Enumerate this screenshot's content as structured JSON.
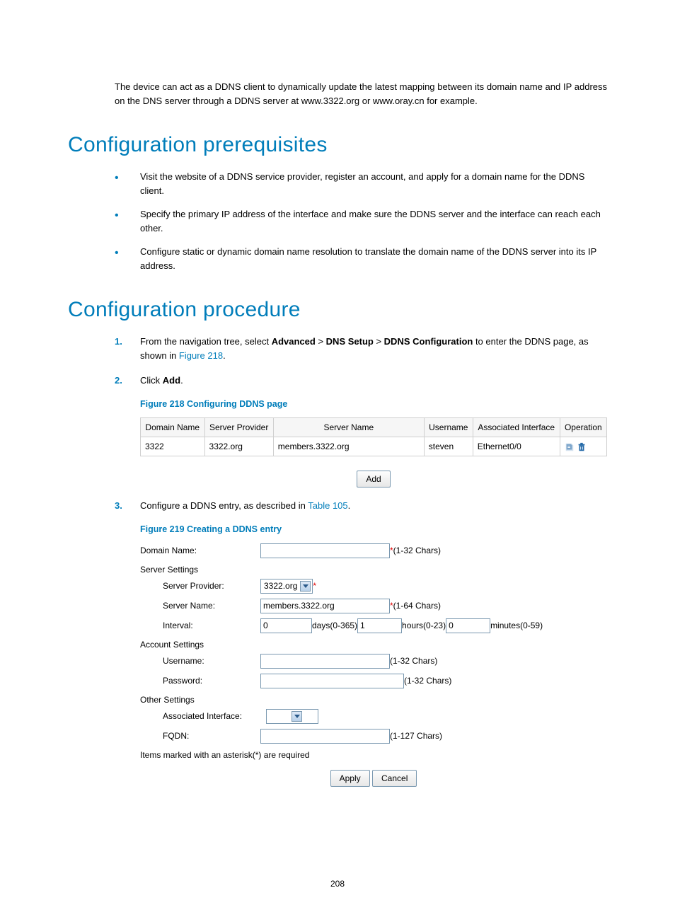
{
  "intro": "The device can act as a DDNS client to dynamically update the latest mapping between its domain name and IP address on the DNS server through a DDNS server at www.3322.org or www.oray.cn for example.",
  "headings": {
    "prereq": "Configuration prerequisites",
    "procedure": "Configuration procedure"
  },
  "prereq_items": [
    "Visit the website of a DDNS service provider, register an account, and apply for a domain name for the DDNS client.",
    "Specify the primary IP address of the interface and make sure the DDNS server and the interface can reach each other.",
    "Configure static or dynamic domain name resolution to translate the domain name of the DDNS server into its IP address."
  ],
  "steps": {
    "s1_pre": "From the navigation tree, select ",
    "s1_b1": "Advanced",
    "s1_gt1": " > ",
    "s1_b2": "DNS Setup",
    "s1_gt2": " > ",
    "s1_b3": "DDNS Configuration",
    "s1_mid": " to enter the DDNS page, as shown in ",
    "s1_link": "Figure 218",
    "s1_end": ".",
    "s2_pre": "Click ",
    "s2_b": "Add",
    "s2_end": ".",
    "s3_pre": "Configure a DDNS entry, as described in ",
    "s3_link": "Table 105",
    "s3_end": "."
  },
  "fig218": {
    "caption": "Figure 218 Configuring DDNS page",
    "headers": [
      "Domain Name",
      "Server Provider",
      "Server Name",
      "Username",
      "Associated Interface",
      "Operation"
    ],
    "row": [
      "3322",
      "3322.org",
      "members.3322.org",
      "steven",
      "Ethernet0/0"
    ],
    "add_btn": "Add"
  },
  "fig219": {
    "caption": "Figure 219 Creating a DDNS entry",
    "labels": {
      "domain": "Domain Name:",
      "server_settings": "Server Settings",
      "provider": "Server Provider:",
      "server_name": "Server Name:",
      "interval": "Interval:",
      "account_settings": "Account Settings",
      "username": "Username:",
      "password": "Password:",
      "other_settings": "Other Settings",
      "assoc_if": "Associated Interface:",
      "fqdn": "FQDN:"
    },
    "values": {
      "provider": "3322.org",
      "server_name": "members.3322.org",
      "days": "0",
      "hours": "1",
      "minutes": "0"
    },
    "hints": {
      "domain": "(1-32 Chars)",
      "server_name": "(1-64 Chars)",
      "days": "days(0-365)",
      "hours": "hours(0-23)",
      "minutes": "minutes(0-59)",
      "username": "(1-32 Chars)",
      "password": "(1-32 Chars)",
      "fqdn": "(1-127 Chars)"
    },
    "footer": "Items marked with an asterisk(*) are required",
    "apply": "Apply",
    "cancel": "Cancel"
  },
  "page_number": "208"
}
